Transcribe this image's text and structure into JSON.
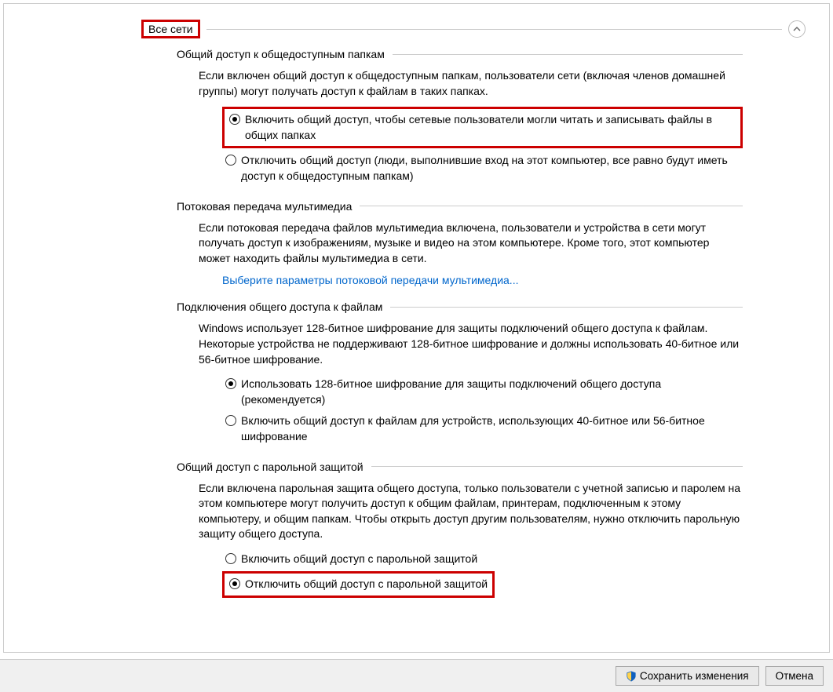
{
  "expander": {
    "title": "Все сети"
  },
  "sections": {
    "publicFolders": {
      "title": "Общий доступ к общедоступным папкам",
      "desc": "Если включен общий доступ к общедоступным папкам, пользователи сети (включая членов домашней группы) могут получать доступ к файлам в таких папках.",
      "opt1": "Включить общий доступ, чтобы сетевые пользователи могли читать и записывать файлы в общих папках",
      "opt2": "Отключить общий доступ (люди, выполнившие вход на этот компьютер, все равно будут иметь доступ к общедоступным папкам)"
    },
    "mediaStreaming": {
      "title": "Потоковая передача мультимедиа",
      "desc": "Если потоковая передача файлов мультимедиа включена, пользователи и устройства в сети могут получать доступ к изображениям, музыке и видео на этом компьютере. Кроме того, этот компьютер может находить файлы мультимедиа в сети.",
      "link": "Выберите параметры потоковой передачи мультимедиа..."
    },
    "fileSharing": {
      "title": "Подключения общего доступа к файлам",
      "desc": "Windows использует 128-битное шифрование для защиты подключений общего доступа к файлам. Некоторые устройства не поддерживают 128-битное шифрование и должны использовать 40-битное или 56-битное шифрование.",
      "opt1": "Использовать 128-битное шифрование для защиты подключений общего доступа (рекомендуется)",
      "opt2": "Включить общий доступ к файлам для устройств, использующих 40-битное или 56-битное шифрование"
    },
    "passwordSharing": {
      "title": "Общий доступ с парольной защитой",
      "desc": "Если включена парольная защита общего доступа, только пользователи с учетной записью и паролем на этом компьютере могут получить доступ к общим файлам, принтерам, подключенным к этому компьютеру, и общим папкам. Чтобы открыть доступ другим пользователям, нужно отключить парольную защиту общего доступа.",
      "opt1": "Включить общий доступ с парольной защитой",
      "opt2": "Отключить общий доступ с парольной защитой"
    }
  },
  "footer": {
    "save": "Сохранить изменения",
    "cancel": "Отмена"
  }
}
